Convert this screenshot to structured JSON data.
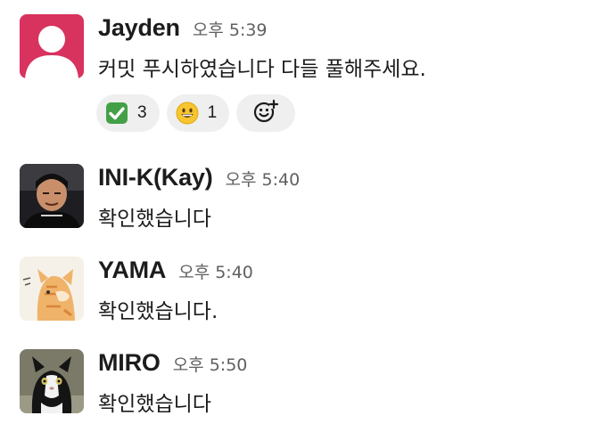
{
  "messages": [
    {
      "author": "Jayden",
      "time": "오후 5:39",
      "text": "커밋 푸시하였습니다 다들 풀해주세요.",
      "avatar_color": "#d8325f",
      "reactions": [
        {
          "emoji": "white-check-mark",
          "count": "3"
        },
        {
          "emoji": "grinning-face",
          "count": "1"
        }
      ],
      "add_reaction_icon": "add-emoji-icon"
    },
    {
      "author": "INI-K(Kay)",
      "time": "오후 5:40",
      "text": "확인했습니다",
      "avatar_color": "#2a2a2a"
    },
    {
      "author": "YAMA",
      "time": "오후 5:40",
      "text": "확인했습니다.",
      "avatar_color": "#e9a35a"
    },
    {
      "author": "MIRO",
      "time": "오후 5:50",
      "text": "확인했습니다",
      "avatar_color": "#3a3a36"
    }
  ]
}
